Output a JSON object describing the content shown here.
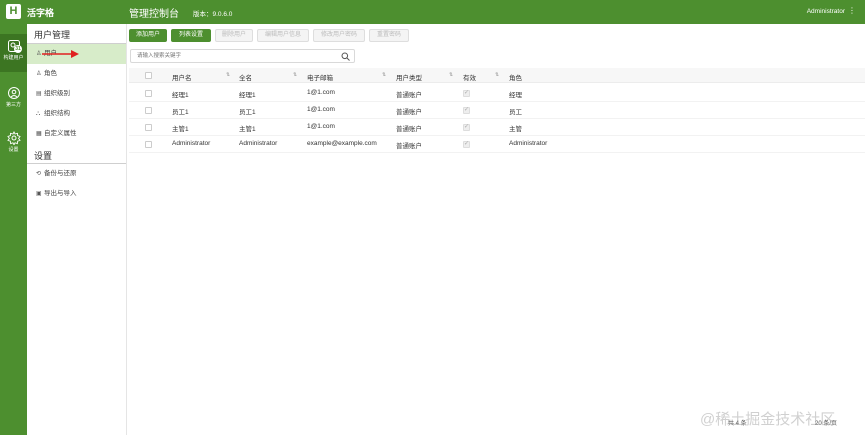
{
  "header": {
    "logo_letter": "H",
    "app_name": "活字格",
    "console_title": "管理控制台",
    "version": "版本：9.0.6.0",
    "user": "Administrator",
    "menu_glyph": "⋮"
  },
  "rail": [
    {
      "label": "构建用户",
      "icon": "users-icon",
      "badge": "31"
    },
    {
      "label": "第三方",
      "icon": "third-party-icon"
    },
    {
      "label": "设置",
      "icon": "gear-icon"
    }
  ],
  "sidebar": {
    "user_section": "用户管理",
    "user_items": [
      {
        "label": "用户",
        "icon": "user-icon"
      },
      {
        "label": "角色",
        "icon": "role-icon"
      },
      {
        "label": "组织级别",
        "icon": "org-level-icon"
      },
      {
        "label": "组织结构",
        "icon": "org-structure-icon"
      },
      {
        "label": "自定义属性",
        "icon": "custom-attr-icon"
      }
    ],
    "settings_section": "设置",
    "settings_items": [
      {
        "label": "备份与还原",
        "icon": "backup-icon"
      },
      {
        "label": "导出与导入",
        "icon": "export-icon"
      }
    ]
  },
  "toolbar": {
    "add_user": "添加用户",
    "column_settings": "列表设置",
    "delete_user": "删除用户",
    "edit_user_info": "编辑用户信息",
    "change_user_password": "修改用户密码",
    "reset_password": "重置密码"
  },
  "search": {
    "placeholder": "请输入搜索关键字"
  },
  "table": {
    "columns": [
      "用户名",
      "全名",
      "电子邮箱",
      "用户类型",
      "有效",
      "角色"
    ],
    "rows": [
      {
        "username": "经理1",
        "fullname": "经理1",
        "email": "1@1.com",
        "type": "普通账户",
        "valid": true,
        "role": "经理"
      },
      {
        "username": "员工1",
        "fullname": "员工1",
        "email": "1@1.com",
        "type": "普通账户",
        "valid": true,
        "role": "员工"
      },
      {
        "username": "主管1",
        "fullname": "主管1",
        "email": "1@1.com",
        "type": "普通账户",
        "valid": true,
        "role": "主管"
      },
      {
        "username": "Administrator",
        "fullname": "Administrator",
        "email": "example@example.com",
        "type": "普通账户",
        "valid": true,
        "role": "Administrator"
      }
    ]
  },
  "footer": {
    "left": "共 4 条",
    "right": "20 条/页"
  },
  "watermark": "@稀土掘金技术社区",
  "colors": {
    "brand": "#4d8f2f",
    "active_bg": "#d7ecc9",
    "arrow": "#e02020"
  }
}
